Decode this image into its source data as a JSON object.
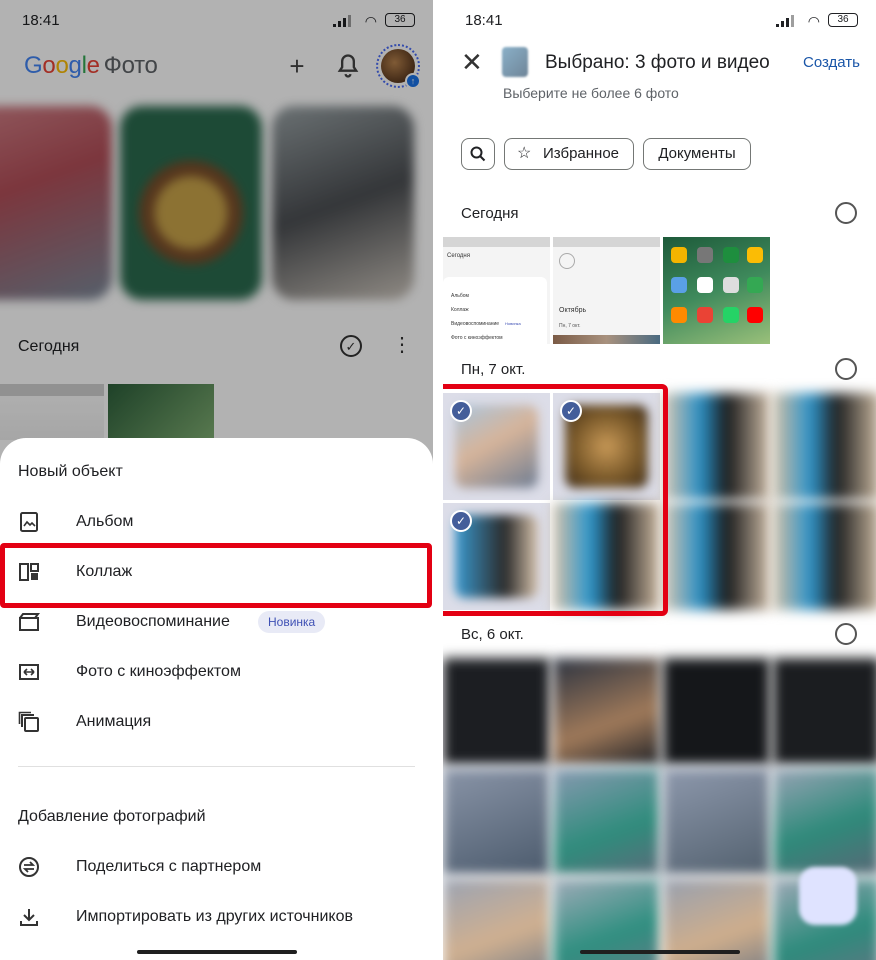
{
  "status": {
    "time": "18:41",
    "battery": "36"
  },
  "left": {
    "logo": {
      "google": "Google",
      "app": "Фото"
    },
    "today_label": "Сегодня",
    "sheet": {
      "section_new": "Новый объект",
      "items_new": [
        {
          "label": "Альбом",
          "icon": "album-icon"
        },
        {
          "label": "Коллаж",
          "icon": "collage-icon"
        },
        {
          "label": "Видеовоспоминание",
          "icon": "movie-icon",
          "badge": "Новинка"
        },
        {
          "label": "Фото с киноэффектом",
          "icon": "cinematic-icon"
        },
        {
          "label": "Анимация",
          "icon": "animation-icon"
        }
      ],
      "section_add": "Добавление фотографий",
      "items_add": [
        {
          "label": "Поделиться с партнером",
          "icon": "partner-share-icon"
        },
        {
          "label": "Импортировать из других источников",
          "icon": "import-icon"
        }
      ]
    }
  },
  "right": {
    "title": "Выбрано: 3 фото и видео",
    "subtitle": "Выберите не более 6 фото",
    "create_label": "Создать",
    "chips": {
      "favorites": "Избранное",
      "documents": "Документы"
    },
    "sections": [
      {
        "date": "Сегодня"
      },
      {
        "date": "Пн, 7 окт."
      },
      {
        "date": "Вс, 6 окт."
      }
    ],
    "thumb_text": {
      "screen1_title": "Сегодня",
      "screen1_rows": [
        "Альбом",
        "Коллаж",
        "Видеовоспоминание",
        "Фото с киноэффектом"
      ],
      "screen1_badge": "Новинка",
      "screen2_title": "Октябрь",
      "screen2_sub": "Пн, 7 окт."
    },
    "selected_count": 3
  }
}
